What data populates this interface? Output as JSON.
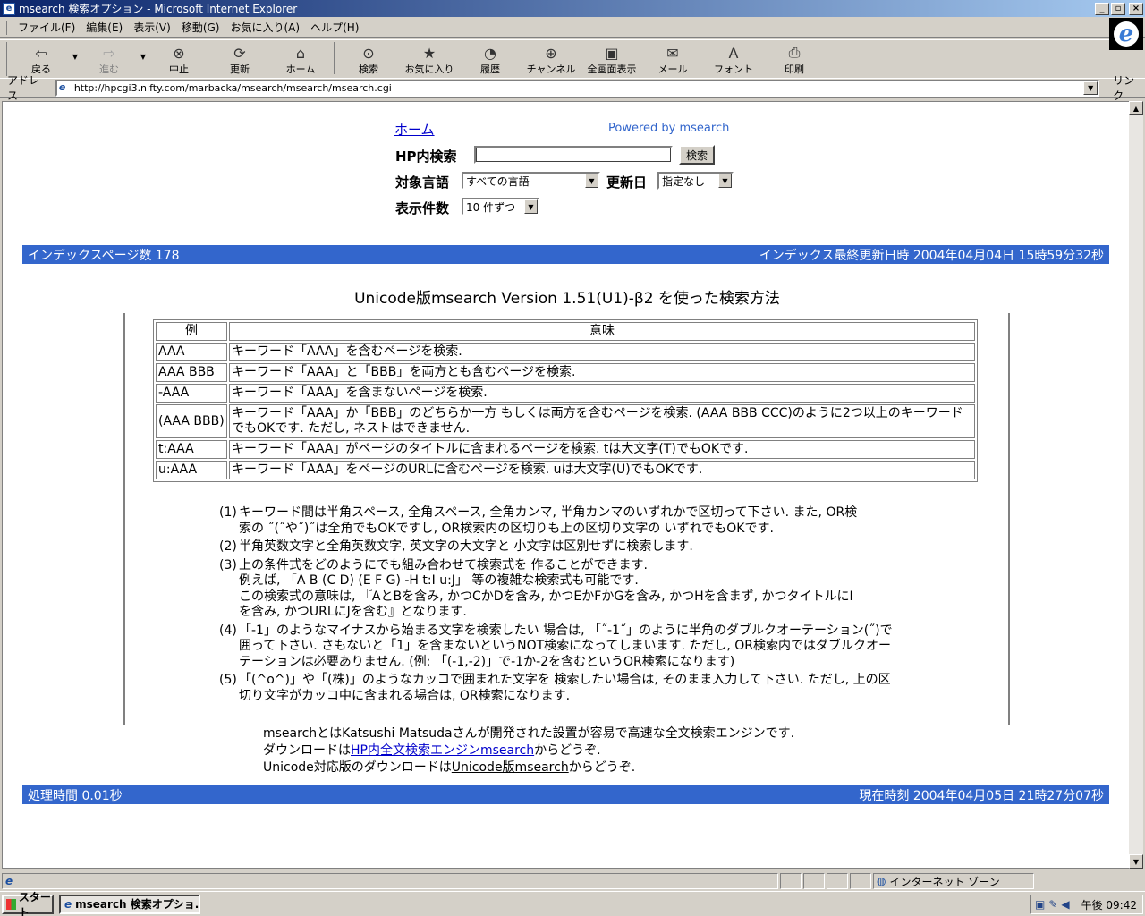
{
  "window": {
    "title": "msearch 検索オプション - Microsoft Internet Explorer",
    "min_glyph": "_",
    "max_glyph": "▫",
    "close_glyph": "×"
  },
  "menu": [
    "ファイル(F)",
    "編集(E)",
    "表示(V)",
    "移動(G)",
    "お気に入り(A)",
    "ヘルプ(H)"
  ],
  "toolbar": {
    "back": "戻る",
    "forward": "進む",
    "stop": "中止",
    "refresh": "更新",
    "home": "ホーム",
    "search": "検索",
    "favorites": "お気に入り",
    "history": "履歴",
    "channels": "チャンネル",
    "fullscreen": "全画面表示",
    "mail": "メール",
    "font": "フォント",
    "print": "印刷"
  },
  "address": {
    "label": "アドレス",
    "url": "http://hpcgi3.nifty.com/marbacka/msearch/msearch/msearch.cgi",
    "links": "リンク"
  },
  "page": {
    "home_link": "ホーム",
    "powered": "Powered by msearch",
    "search_label": "HP内検索",
    "search_button": "検索",
    "search_value": "",
    "lang_label": "対象言語",
    "lang_value": "すべての言語",
    "updated_label": "更新日",
    "updated_value": "指定なし",
    "count_label": "表示件数",
    "count_value": "10 件ずつ",
    "index_pages": "インデックスページ数 178",
    "index_updated": "インデックス最終更新日時 2004年04月04日 15時59分32秒",
    "heading": "Unicode版msearch Version 1.51(U1)-β2 を使った検索方法",
    "table_headers": [
      "例",
      "意味"
    ],
    "table_rows": [
      [
        "AAA",
        "キーワード「AAA」を含むページを検索."
      ],
      [
        "AAA BBB",
        "キーワード「AAA」と「BBB」を両方とも含むページを検索."
      ],
      [
        "-AAA",
        "キーワード「AAA」を含まないページを検索."
      ],
      [
        "(AAA BBB)",
        "キーワード「AAA」か「BBB」のどちらか一方 もしくは両方を含むページを検索. (AAA BBB CCC)のように2つ以上のキーワードでもOKです. ただし, ネストはできません."
      ],
      [
        "t:AAA",
        "キーワード「AAA」がページのタイトルに含まれるページを検索. tは大文字(T)でもOKです."
      ],
      [
        "u:AAA",
        "キーワード「AAA」をページのURLに含むページを検索. uは大文字(U)でもOKです."
      ]
    ],
    "notes": [
      {
        "num": "(1)",
        "text": "キーワード間は半角スペース, 全角スペース, 全角カンマ, 半角カンマのいずれかで区切って下さい. また, OR検\n索の ˝(˝や˝)˝は全角でもOKですし, OR検索内の区切りも上の区切り文字の いずれでもOKです."
      },
      {
        "num": "(2)",
        "text": "半角英数文字と全角英数文字, 英文字の大文字と 小文字は区別せずに検索します."
      },
      {
        "num": "(3)",
        "text": "上の条件式をどのようにでも組み合わせて検索式を 作ることができます.\n例えば, 「A B (C D) (E F G) -H t:I u:J」 等の複雑な検索式も可能です.\nこの検索式の意味は, 『AとBを含み, かつCかDを含み, かつEかFかGを含み, かつHを含まず, かつタイトルにI\nを含み, かつURLにJを含む』となります."
      },
      {
        "num": "(4)",
        "text": "「-1」のようなマイナスから始まる文字を検索したい 場合は, 「˝-1˝」のように半角のダブルクオーテーション(˝)で\n囲って下さい. さもないと「1」を含まないというNOT検索になってしまいます. ただし, OR検索内ではダブルクオー\nテーションは必要ありません. (例: 「(-1,-2)」で-1か-2を含むというOR検索になります)"
      },
      {
        "num": "(5)",
        "text": "「(^o^)」や「(株)」のようなカッコで囲まれた文字を 検索したい場合は, そのまま入力して下さい. ただし, 上の区\n切り文字がカッコ中に含まれる場合は, OR検索になります."
      }
    ],
    "credit_line1": "msearchとはKatsushi Matsudaさんが開発された設置が容易で高速な全文検索エンジンです.",
    "credit_line2_pre": "ダウンロードは",
    "credit_line2_link": "HP内全文検索エンジンmsearch",
    "credit_line2_post": "からどうぞ.",
    "credit_line3_pre": "Unicode対応版のダウンロードは",
    "credit_line3_link": "Unicode版msearch",
    "credit_line3_post": "からどうぞ.",
    "proc_time": "処理時間 0.01秒",
    "current_time": "現在時刻 2004年04月05日 21時27分07秒"
  },
  "status": {
    "zone": "インターネット ゾーン"
  },
  "taskbar": {
    "start": "スタート",
    "task": "msearch 検索オプショ...",
    "clock": "午後 09:42"
  }
}
